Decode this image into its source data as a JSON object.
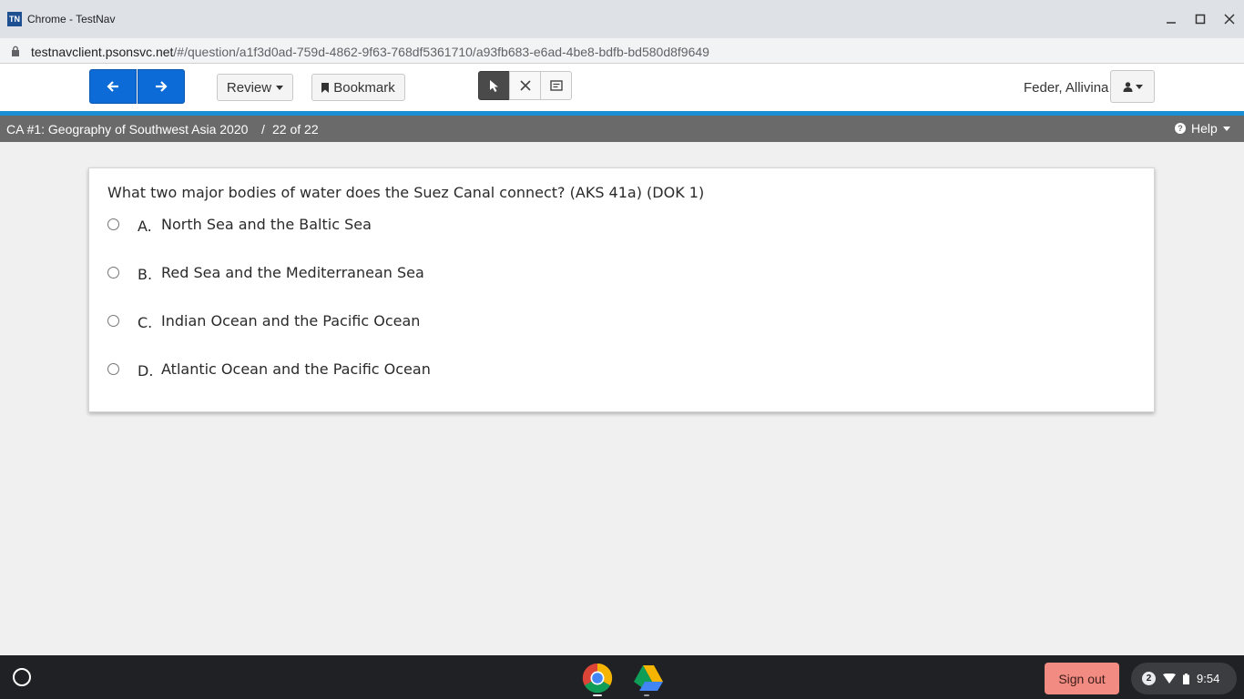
{
  "window": {
    "logo_text": "TN",
    "title": "Chrome - TestNav"
  },
  "address_bar": {
    "host": "testnavclient.psonsvc.net",
    "path": "/#/question/a1f3d0ad-759d-4862-9f63-768df5361710/a93fb683-e6ad-4be8-bdfb-bd580d8f9649"
  },
  "toolbar": {
    "review_label": "Review",
    "bookmark_label": "Bookmark",
    "user_name": "Feder, Allivina"
  },
  "test_bar": {
    "title": "CA #1: Geography of Southwest Asia 2020",
    "separator": "/",
    "progress": "22 of 22",
    "help_label": "Help"
  },
  "question": {
    "prompt": "What two major bodies of water does the Suez Canal connect? (AKS 41a) (DOK 1)",
    "options": [
      {
        "letter": "A.",
        "text": "North Sea and the Baltic Sea"
      },
      {
        "letter": "B.",
        "text": "Red Sea and the Mediterranean Sea"
      },
      {
        "letter": "C.",
        "text": "Indian Ocean and the Pacific Ocean"
      },
      {
        "letter": "D.",
        "text": "Atlantic Ocean and the Pacific Ocean"
      }
    ]
  },
  "shelf": {
    "signout_label": "Sign out",
    "notification_count": "2",
    "time": "9:54"
  },
  "colors": {
    "nav_blue": "#0c6bd6",
    "accent_line": "#1a8fd6",
    "info_bar": "#6a6a6a",
    "signout_bg": "#f28b82",
    "shelf_bg": "#202124"
  },
  "icons": {
    "back": "arrow-left-icon",
    "forward": "arrow-right-icon",
    "pointer": "pointer-icon",
    "eliminator": "answer-eliminator-icon",
    "notepad": "notepad-icon",
    "user_menu": "user-icon",
    "help": "question-circle-icon"
  }
}
